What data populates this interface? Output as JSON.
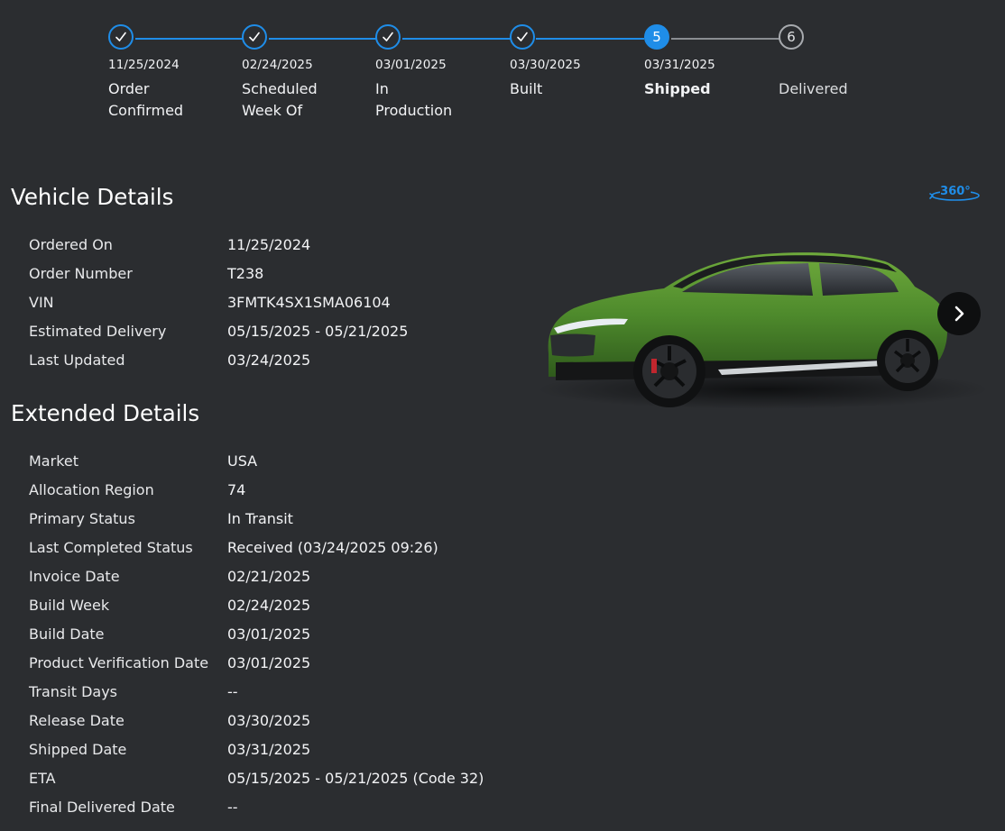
{
  "tracker": {
    "steps": [
      {
        "number": "1",
        "date": "11/25/2024",
        "label_line1": "Order",
        "label_line2": "Confirmed",
        "state": "complete"
      },
      {
        "number": "2",
        "date": "02/24/2025",
        "label_line1": "Scheduled",
        "label_line2": "Week Of",
        "state": "complete"
      },
      {
        "number": "3",
        "date": "03/01/2025",
        "label_line1": "In",
        "label_line2": "Production",
        "state": "complete"
      },
      {
        "number": "4",
        "date": "03/30/2025",
        "label_line1": "Built",
        "label_line2": "",
        "state": "complete"
      },
      {
        "number": "5",
        "date": "03/31/2025",
        "label_line1": "Shipped",
        "label_line2": "",
        "state": "active"
      },
      {
        "number": "6",
        "date": "",
        "label_line1": "Delivered",
        "label_line2": "",
        "state": "pending"
      }
    ]
  },
  "vehicle_details": {
    "title": "Vehicle Details",
    "rows": [
      {
        "key": "Ordered On",
        "value": "11/25/2024"
      },
      {
        "key": "Order Number",
        "value": "T238"
      },
      {
        "key": "VIN",
        "value": "3FMTK4SX1SMA06104"
      },
      {
        "key": "Estimated Delivery",
        "value": "05/15/2025 - 05/21/2025"
      },
      {
        "key": "Last Updated",
        "value": "03/24/2025"
      }
    ]
  },
  "extended_details": {
    "title": "Extended Details",
    "rows": [
      {
        "key": "Market",
        "value": "USA"
      },
      {
        "key": "Allocation Region",
        "value": "74"
      },
      {
        "key": "Primary Status",
        "value": "In Transit"
      },
      {
        "key": "Last Completed Status",
        "value": "Received (03/24/2025 09:26)"
      },
      {
        "key": "Invoice Date",
        "value": "02/21/2025"
      },
      {
        "key": "Build Week",
        "value": "02/24/2025"
      },
      {
        "key": "Build Date",
        "value": "03/01/2025"
      },
      {
        "key": "Product Verification Date",
        "value": "03/01/2025"
      },
      {
        "key": "Transit Days",
        "value": "--"
      },
      {
        "key": "Release Date",
        "value": "03/30/2025"
      },
      {
        "key": "Shipped Date",
        "value": "03/31/2025"
      },
      {
        "key": "ETA",
        "value": "05/15/2025 - 05/21/2025 (Code 32)"
      },
      {
        "key": "Final Delivered Date",
        "value": "--"
      }
    ]
  },
  "viewer": {
    "view_360_label": "360°",
    "view_360_icon": "rotate-360-icon",
    "next_icon": "chevron-right-icon",
    "car_color": "#4e8a2c"
  },
  "colors": {
    "accent": "#1f8de8",
    "background": "#2b2d30",
    "pending": "#a7aaae"
  }
}
